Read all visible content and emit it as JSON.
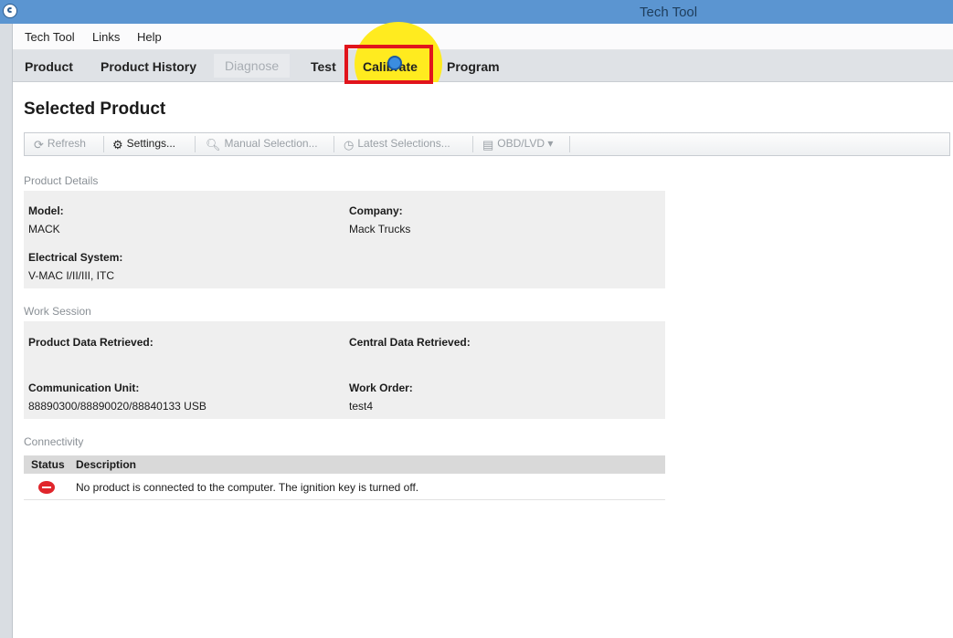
{
  "window": {
    "title": "Tech Tool"
  },
  "menu": [
    "Tech Tool",
    "Links",
    "Help"
  ],
  "tabs": [
    "Product",
    "Product History",
    "Diagnose",
    "Test",
    "Calibrate",
    "Program"
  ],
  "page": {
    "title": "Selected Product"
  },
  "toolbar": {
    "refresh": "Refresh",
    "settings": "Settings...",
    "manual_selection": "Manual Selection...",
    "latest_selections": "Latest Selections...",
    "obd_lvd": "OBD/LVD ▾"
  },
  "product_details": {
    "section": "Product Details",
    "model_label": "Model:",
    "model_value": "MACK",
    "company_label": "Company:",
    "company_value": "Mack Trucks",
    "electrical_label": "Electrical System:",
    "electrical_value": "V-MAC I/II/III, ITC"
  },
  "work_session": {
    "section": "Work Session",
    "product_data_label": "Product Data Retrieved:",
    "central_data_label": "Central Data Retrieved:",
    "comm_unit_label": "Communication Unit:",
    "comm_unit_value": "88890300/88890020/88840133 USB",
    "work_order_label": "Work Order:",
    "work_order_value": "test4"
  },
  "connectivity": {
    "section": "Connectivity",
    "col_status": "Status",
    "col_description": "Description",
    "rows": [
      {
        "description": "No product is connected to the computer. The ignition key is turned off."
      }
    ]
  },
  "colors": {
    "titlebar": "#5b95d1",
    "highlight_yellow": "#ffeb1f",
    "highlight_red": "#e1141c",
    "status_error": "#e0252b"
  }
}
